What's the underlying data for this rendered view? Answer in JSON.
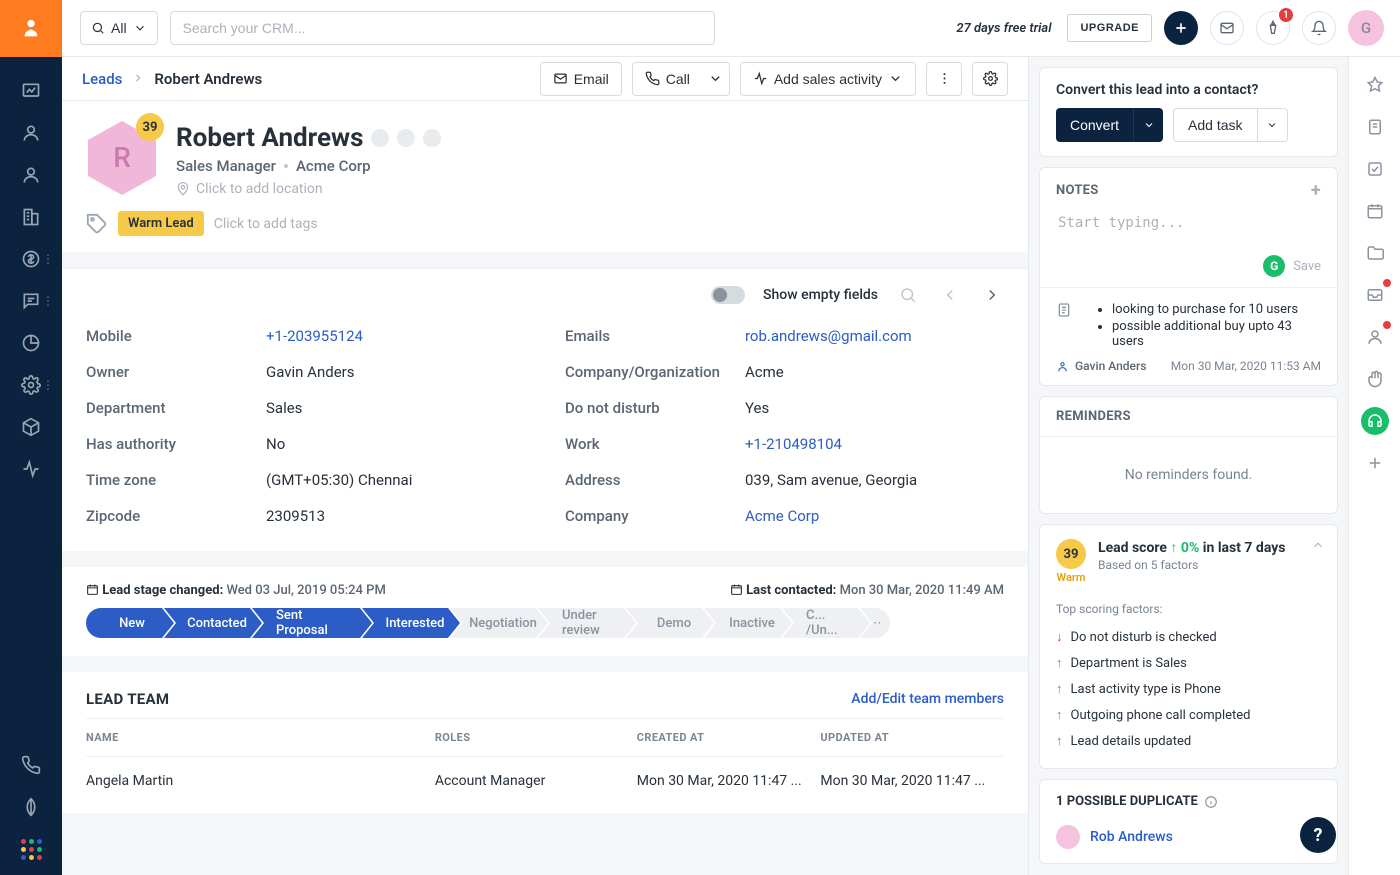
{
  "topbar": {
    "filter_label": "All",
    "search_placeholder": "Search your CRM...",
    "trial_text": "27 days free trial",
    "upgrade_label": "UPGRADE",
    "notif_badge": "1",
    "avatar_initial": "G"
  },
  "breadcrumb": {
    "root": "Leads",
    "leaf": "Robert Andrews"
  },
  "header_actions": {
    "email": "Email",
    "call": "Call",
    "add_activity": "Add sales activity"
  },
  "profile": {
    "name": "Robert Andrews",
    "score_badge": "39",
    "avatar_letter": "R",
    "job": "Sales Manager",
    "company": "Acme Corp",
    "location_placeholder": "Click to add location",
    "tag_label": "Warm Lead",
    "tag_placeholder": "Click to add tags"
  },
  "details_ui": {
    "show_empty_label": "Show empty fields"
  },
  "details": {
    "mobile": {
      "label": "Mobile",
      "value": "+1-203955124"
    },
    "owner": {
      "label": "Owner",
      "value": "Gavin Anders"
    },
    "department": {
      "label": "Department",
      "value": "Sales"
    },
    "authority": {
      "label": "Has authority",
      "value": "No"
    },
    "timezone": {
      "label": "Time zone",
      "value": "(GMT+05:30) Chennai"
    },
    "zip": {
      "label": "Zipcode",
      "value": "2309513"
    },
    "emails": {
      "label": "Emails",
      "value": "rob.andrews@gmail.com"
    },
    "org": {
      "label": "Company/Organization",
      "value": "Acme"
    },
    "dnd": {
      "label": "Do not disturb",
      "value": "Yes"
    },
    "work": {
      "label": "Work",
      "value": "+1-210498104"
    },
    "address": {
      "label": "Address",
      "value": "039, Sam avenue, Georgia"
    },
    "company": {
      "label": "Company",
      "value": "Acme Corp"
    }
  },
  "pipeline": {
    "changed_label": "Lead stage changed:",
    "changed_val": "Wed 03 Jul, 2019 05:24 PM",
    "contacted_label": "Last contacted:",
    "contacted_val": "Mon 30 Mar, 2020 11:49 AM",
    "stages": [
      "New",
      "Contacted",
      "Sent Proposal",
      "Interested",
      "Negotiation",
      "Under review",
      "Demo",
      "Inactive",
      "C... /Un..."
    ]
  },
  "team": {
    "title": "LEAD TEAM",
    "edit_link": "Add/Edit team members",
    "cols": {
      "name": "NAME",
      "roles": "ROLES",
      "created": "CREATED AT",
      "updated": "UPDATED AT"
    },
    "rows": [
      {
        "name": "Angela Martin",
        "role": "Account Manager",
        "created": "Mon 30 Mar, 2020 11:47 ...",
        "updated": "Mon 30 Mar, 2020 11:47 ..."
      }
    ]
  },
  "right": {
    "convert_prompt": "Convert this lead into a contact?",
    "convert_btn": "Convert",
    "add_task_btn": "Add task",
    "notes": {
      "title": "NOTES",
      "placeholder": "Start typing...",
      "save_label": "Save",
      "bullets": [
        "looking to purchase for 10 users",
        "possible additional buy upto 43 users"
      ],
      "author": "Gavin Anders",
      "timestamp": "Mon 30 Mar, 2020 11:53 AM"
    },
    "reminders": {
      "title": "REMINDERS",
      "empty": "No reminders found."
    },
    "score": {
      "value": "39",
      "warm_label": "Warm",
      "lead_score_label": "Lead score",
      "delta": "0%",
      "delta_suffix": "in last 7 days",
      "based_on": "Based on 5 factors",
      "factors_head": "Top scoring factors:",
      "factors": [
        {
          "dir": "down",
          "text": "Do not disturb is checked"
        },
        {
          "dir": "up",
          "text": "Department is Sales"
        },
        {
          "dir": "up",
          "text": "Last activity type is Phone"
        },
        {
          "dir": "up",
          "text": "Outgoing phone call completed"
        },
        {
          "dir": "up",
          "text": "Lead details updated"
        }
      ]
    },
    "duplicate": {
      "title": "1 POSSIBLE DUPLICATE",
      "name": "Rob Andrews"
    }
  }
}
